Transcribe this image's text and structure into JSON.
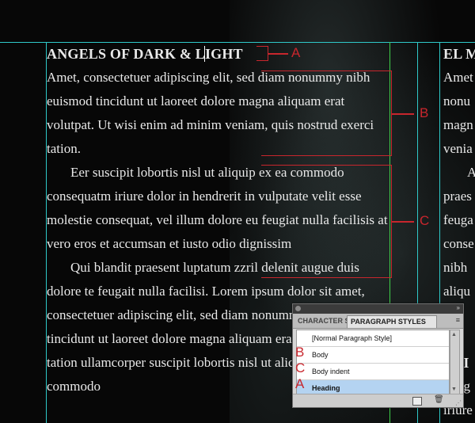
{
  "document": {
    "heading": "ANGELS OF DARK & LIGHT",
    "paragraphs": [
      "Amet, consectetuer adipiscing elit, sed diam nonummy nibh euismod tincidunt ut laoreet dolore magna aliquam erat volutpat. Ut wisi enim ad minim veniam, quis nostrud exerci tation.",
      "Eer suscipit lobortis nisl ut aliquip ex ea commodo consequatm iriure dolor in hendrerit in vulputate velit esse molestie consequat, vel illum dolore eu feugiat nulla facilisis at vero eros et accumsan et iusto odio dignissim",
      "Qui blandit praesent luptatum zzril delenit augue duis dolore te feugait nulla facilisi. Lorem ipsum dolor sit amet, consectetuer adipiscing elit, sed diam nonummy nibh euismod tincidunt ut laoreet dolore magna aliquam erat volutpatrci tation ullamcorper suscipit lobortis nisl ut aliquip ex ea commodo"
    ],
    "second_column": {
      "heading": "EL M",
      "lines": [
        "Amet",
        "nonu",
        "magn",
        "venia",
        "A",
        "praes",
        "feuga",
        "conse",
        "nibh",
        "aliqu",
        "",
        "",
        "ERI",
        "Feug",
        "iriure"
      ]
    }
  },
  "annotations": {
    "heading": "A",
    "body": "B",
    "body_indent": "C"
  },
  "panel": {
    "tabs": {
      "character": "CHARACTER STYLES",
      "paragraph": "PARAGRAPH STYLES"
    },
    "collapse_icon": "»",
    "menu_icon": "≡",
    "styles": [
      {
        "letter": "",
        "label": "[Normal Paragraph Style]"
      },
      {
        "letter": "B",
        "label": "Body"
      },
      {
        "letter": "C",
        "label": "Body indent"
      },
      {
        "letter": "A",
        "label": "Heading"
      }
    ],
    "selected_style": "Heading",
    "footer": {
      "new_icon": "new-style-icon",
      "delete_icon": "🗑"
    }
  },
  "colors": {
    "guide": "#2fc9c9",
    "column_guide": "#3fd04a",
    "annotation": "#c8262d",
    "selection": "#b4d3f1"
  }
}
